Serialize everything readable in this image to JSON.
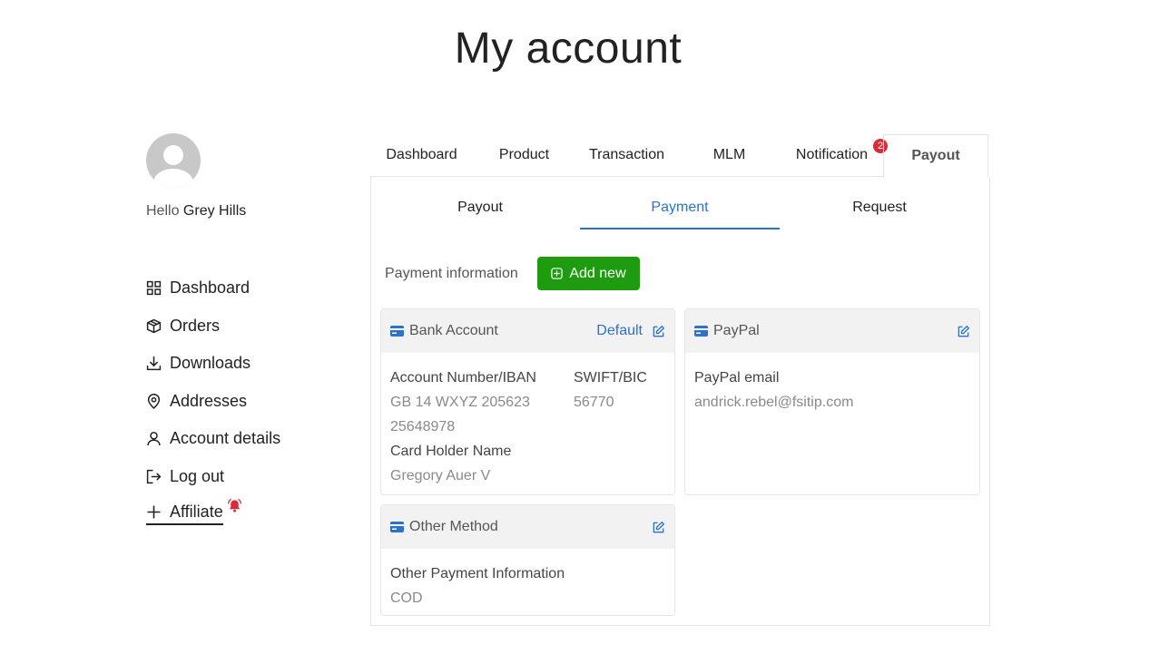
{
  "page": {
    "title": "My account"
  },
  "user": {
    "greeting": "Hello",
    "name": "Grey Hills"
  },
  "sidebar": {
    "items": [
      {
        "label": "Dashboard",
        "icon": "grid-icon"
      },
      {
        "label": "Orders",
        "icon": "package-icon"
      },
      {
        "label": "Downloads",
        "icon": "download-icon"
      },
      {
        "label": "Addresses",
        "icon": "map-pin-icon"
      },
      {
        "label": "Account details",
        "icon": "user-icon"
      },
      {
        "label": "Log out",
        "icon": "logout-icon"
      },
      {
        "label": "Affiliate",
        "icon": "plus-icon"
      }
    ]
  },
  "tabs": [
    {
      "label": "Dashboard"
    },
    {
      "label": "Product"
    },
    {
      "label": "Transaction"
    },
    {
      "label": "MLM"
    },
    {
      "label": "Notification",
      "badge": "2"
    },
    {
      "label": "Payout"
    }
  ],
  "subtabs": [
    {
      "label": "Payout"
    },
    {
      "label": "Payment"
    },
    {
      "label": "Request"
    }
  ],
  "payment": {
    "section_label": "Payment information",
    "add_label": "Add new",
    "bank": {
      "title": "Bank Account",
      "default_label": "Default",
      "account_label": "Account Number/IBAN",
      "account_value_1": "GB 14 WXYZ 205623",
      "account_value_2": "25648978",
      "swift_label": "SWIFT/BIC",
      "swift_value": "56770",
      "holder_label": "Card Holder Name",
      "holder_value": "Gregory Auer V"
    },
    "paypal": {
      "title": "PayPal",
      "email_label": "PayPal email",
      "email_value": "andrick.rebel@fsitip.com"
    },
    "other": {
      "title": "Other Method",
      "info_label": "Other Payment Information",
      "info_value": "COD"
    }
  },
  "colors": {
    "accent": "#2b73c9",
    "add_button": "#1f9b0f",
    "badge": "#dc2b38"
  }
}
